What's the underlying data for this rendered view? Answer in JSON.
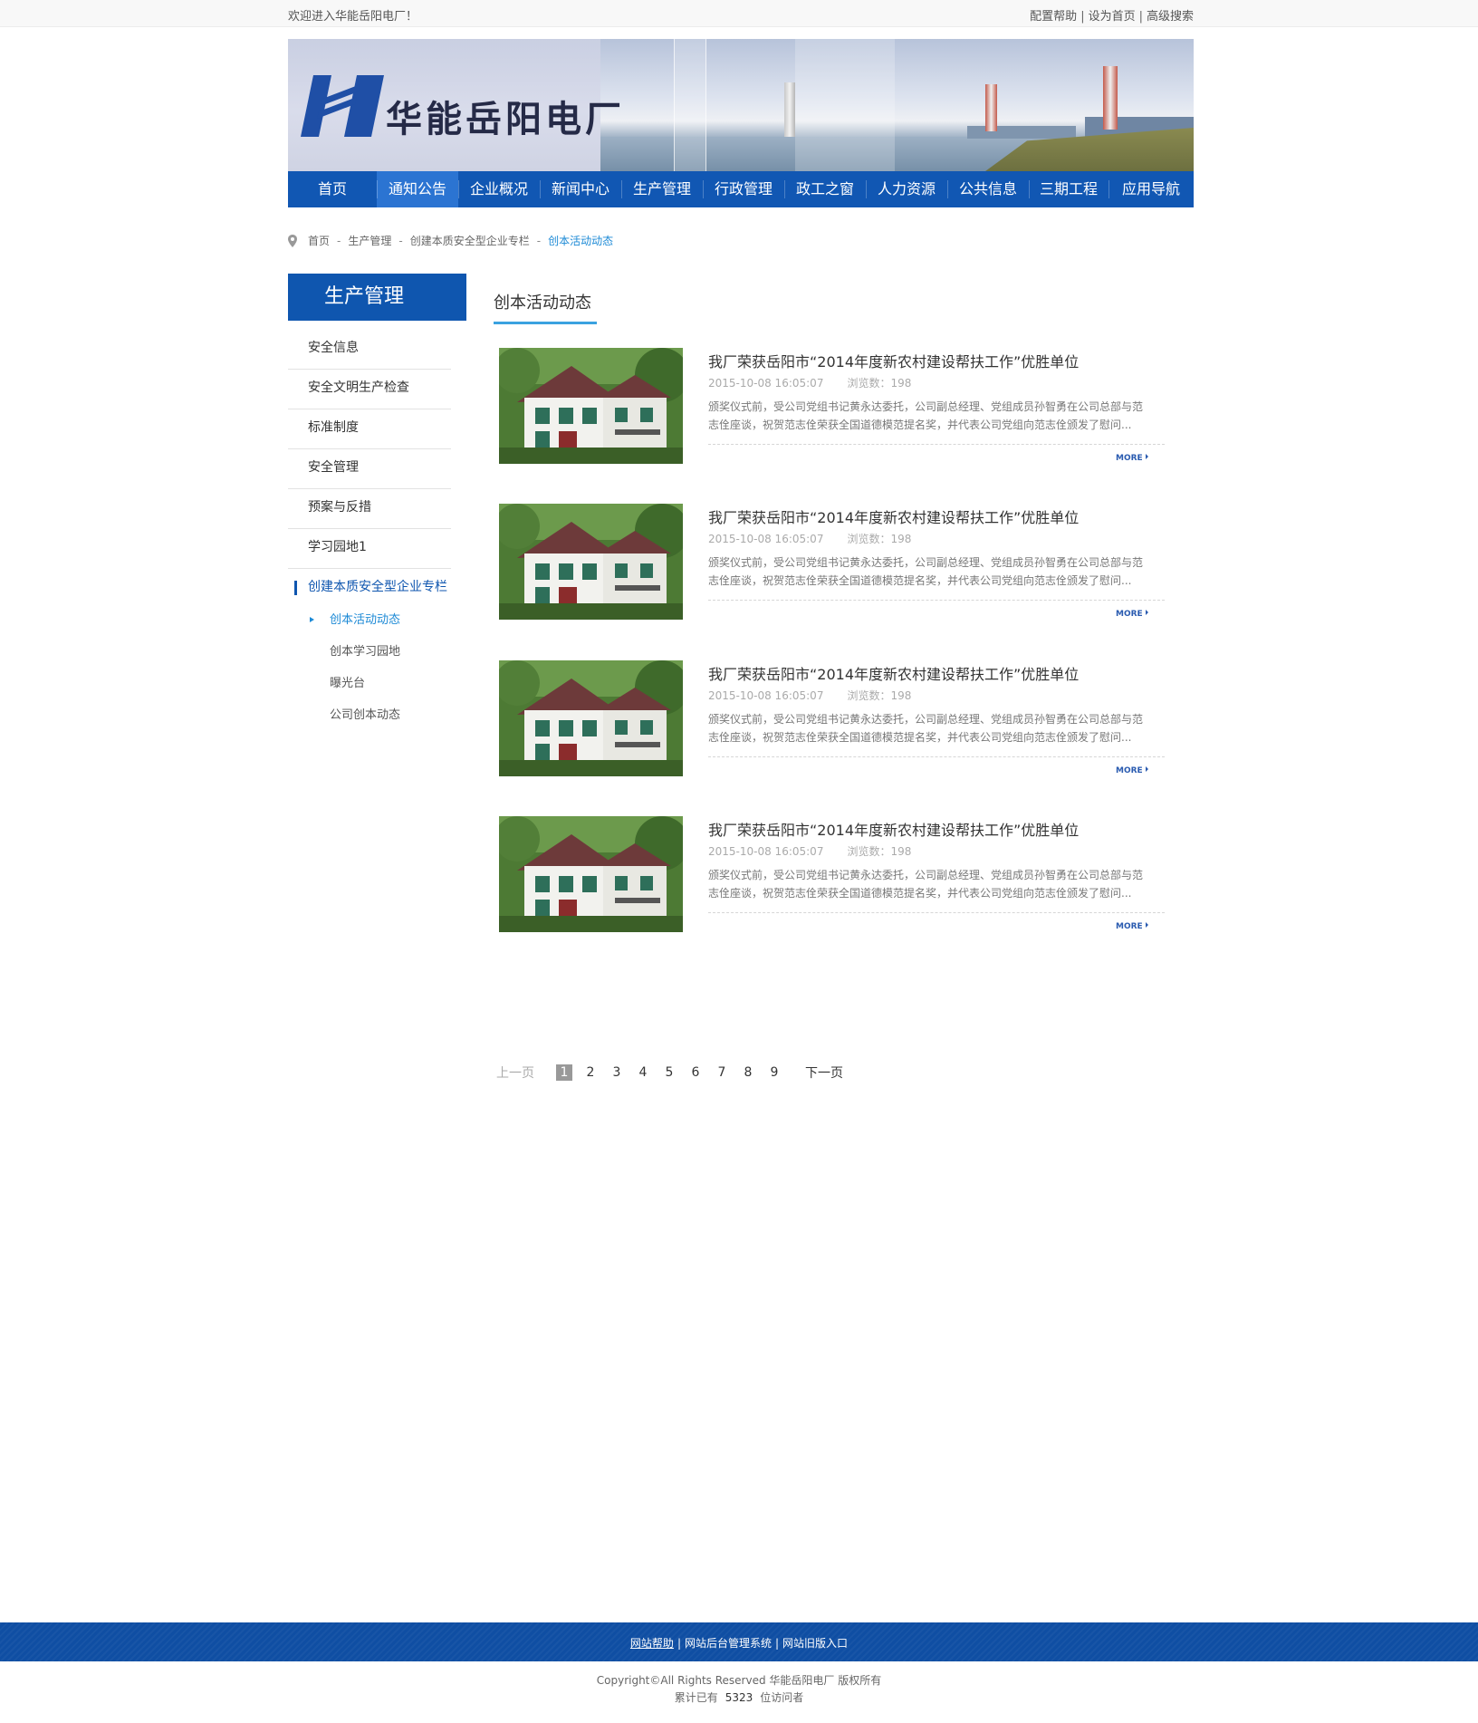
{
  "topbar": {
    "welcome": "欢迎进入华能岳阳电厂！",
    "links": [
      "配置帮助",
      "设为首页",
      "高级搜索"
    ]
  },
  "banner": {
    "logo_text": "华能岳阳电厂"
  },
  "nav": {
    "items": [
      "首页",
      "通知公告",
      "企业概况",
      "新闻中心",
      "生产管理",
      "行政管理",
      "政工之窗",
      "人力资源",
      "公共信息",
      "三期工程",
      "应用导航"
    ],
    "active_index": 1
  },
  "breadcrumb": {
    "items": [
      "首页",
      "生产管理",
      "创建本质安全型企业专栏"
    ],
    "current": "创本活动动态"
  },
  "sidebar": {
    "title": "生产管理",
    "items": [
      "安全信息",
      "安全文明生产检查",
      "标准制度",
      "安全管理",
      "预案与反措",
      "学习园地1",
      "创建本质安全型企业专栏"
    ],
    "subitems": [
      "创本活动动态",
      "创本学习园地",
      "曝光台",
      "公司创本动态"
    ]
  },
  "main": {
    "title": "创本活动动态",
    "articles": [
      {
        "title": "我厂荣获岳阳市“2014年度新农村建设帮扶工作”优胜单位",
        "date": "2015-10-08  16:05:07",
        "views": "浏览数：198",
        "summary": "颁奖仪式前，受公司党组书记黄永达委托，公司副总经理、党组成员孙智勇在公司总部与范志佺座谈，祝贺范志佺荣获全国道德模范提名奖，并代表公司党组向范志佺颁发了慰问...",
        "more": "MORE"
      },
      {
        "title": "我厂荣获岳阳市“2014年度新农村建设帮扶工作”优胜单位",
        "date": "2015-10-08  16:05:07",
        "views": "浏览数：198",
        "summary": "颁奖仪式前，受公司党组书记黄永达委托，公司副总经理、党组成员孙智勇在公司总部与范志佺座谈，祝贺范志佺荣获全国道德模范提名奖，并代表公司党组向范志佺颁发了慰问...",
        "more": "MORE"
      },
      {
        "title": "我厂荣获岳阳市“2014年度新农村建设帮扶工作”优胜单位",
        "date": "2015-10-08  16:05:07",
        "views": "浏览数：198",
        "summary": "颁奖仪式前，受公司党组书记黄永达委托，公司副总经理、党组成员孙智勇在公司总部与范志佺座谈，祝贺范志佺荣获全国道德模范提名奖，并代表公司党组向范志佺颁发了慰问...",
        "more": "MORE"
      },
      {
        "title": "我厂荣获岳阳市“2014年度新农村建设帮扶工作”优胜单位",
        "date": "2015-10-08  16:05:07",
        "views": "浏览数：198",
        "summary": "颁奖仪式前，受公司党组书记黄永达委托，公司副总经理、党组成员孙智勇在公司总部与范志佺座谈，祝贺范志佺荣获全国道德模范提名奖，并代表公司党组向范志佺颁发了慰问...",
        "more": "MORE"
      }
    ]
  },
  "pager": {
    "prev": "上一页",
    "pages": [
      "1",
      "2",
      "3",
      "4",
      "5",
      "6",
      "7",
      "8",
      "9"
    ],
    "current": "1",
    "next": "下一页"
  },
  "footer": {
    "links": [
      "网站帮助",
      "网站后台管理系统",
      "网站旧版入口"
    ],
    "copyright": "Copyright©All Rights Reserved  华能岳阳电厂  版权所有",
    "visits_prefix": "累计已有",
    "visits_count": "5323",
    "visits_suffix": "位访问者"
  },
  "colors": {
    "brand_blue": "#1157b3",
    "nav_active": "#2b74d2",
    "accent_cyan": "#1d8ad6",
    "footer_blue": "#0f4ea3"
  }
}
